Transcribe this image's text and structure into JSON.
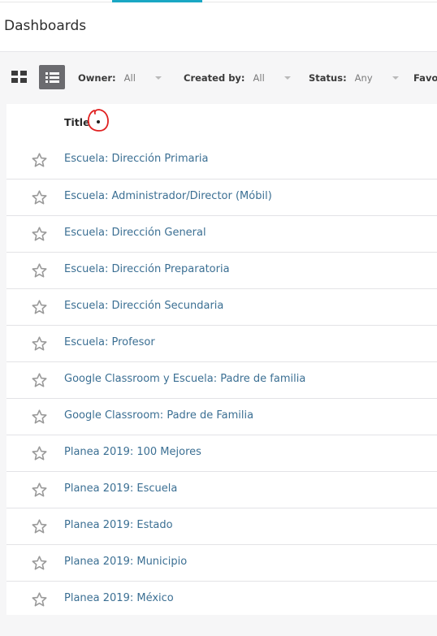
{
  "header": {
    "title": "Dashboards"
  },
  "toolbar": {
    "view_modes": [
      {
        "name": "grid",
        "icon": "grid-view-icon",
        "active": false
      },
      {
        "name": "list",
        "icon": "list-view-icon",
        "active": true
      }
    ],
    "filters": [
      {
        "label": "Owner:",
        "value": "All"
      },
      {
        "label": "Created by:",
        "value": "All"
      },
      {
        "label": "Status:",
        "value": "Any"
      },
      {
        "label": "Favor"
      }
    ]
  },
  "table": {
    "column_title": "Title",
    "sort": "ascending",
    "rows": [
      {
        "title": "Escuela: Dirección Primaria",
        "icon": "star-icon"
      },
      {
        "title": "Escuela: Administrador/Director (Móbil)",
        "icon": "star-icon"
      },
      {
        "title": "Escuela: Dirección General",
        "icon": "star-icon"
      },
      {
        "title": "Escuela: Dirección Preparatoria",
        "icon": "star-icon"
      },
      {
        "title": "Escuela: Dirección Secundaria",
        "icon": "star-icon"
      },
      {
        "title": "Escuela: Profesor",
        "icon": "star-icon"
      },
      {
        "title": "Google Classroom y Escuela: Padre de familia",
        "icon": "star-icon"
      },
      {
        "title": "Google Classroom: Padre de Familia",
        "icon": "star-icon"
      },
      {
        "title": "Planea 2019: 100 Mejores",
        "icon": "star-icon"
      },
      {
        "title": "Planea 2019: Escuela",
        "icon": "star-icon"
      },
      {
        "title": "Planea 2019: Estado",
        "icon": "star-icon"
      },
      {
        "title": "Planea 2019: Municipio",
        "icon": "star-icon"
      },
      {
        "title": "Planea 2019: México",
        "icon": "star-icon"
      }
    ]
  },
  "colors": {
    "link": "#3b6f93",
    "accent": "#1aa7c4",
    "active_view": "#6b6b6f",
    "annotation": "#e02020"
  }
}
